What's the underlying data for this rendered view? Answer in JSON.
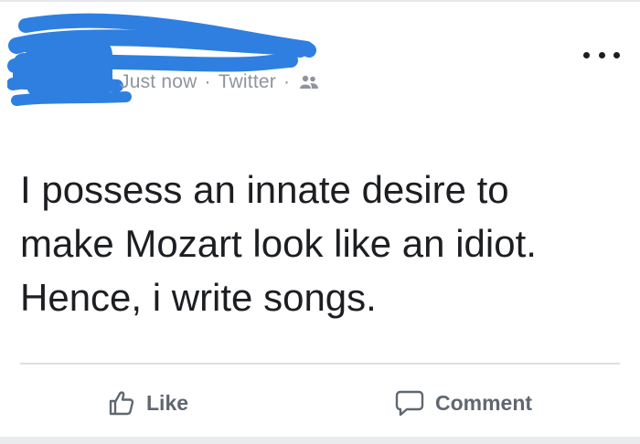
{
  "post": {
    "meta": {
      "time": "Just now",
      "separator": "·",
      "source": "Twitter",
      "audience_icon": "friends-icon"
    },
    "more_icon": "more-options-icon",
    "text": "I possess an innate desire to\nmake Mozart look like an idiot.\nHence, i write songs.",
    "actions": {
      "like_label": "Like",
      "comment_label": "Comment"
    }
  },
  "colors": {
    "redaction": "#2f7fe0",
    "meta_text": "#90949c",
    "body_text": "#1c1e21",
    "action_text": "#606770",
    "divider": "#dddfe2"
  }
}
